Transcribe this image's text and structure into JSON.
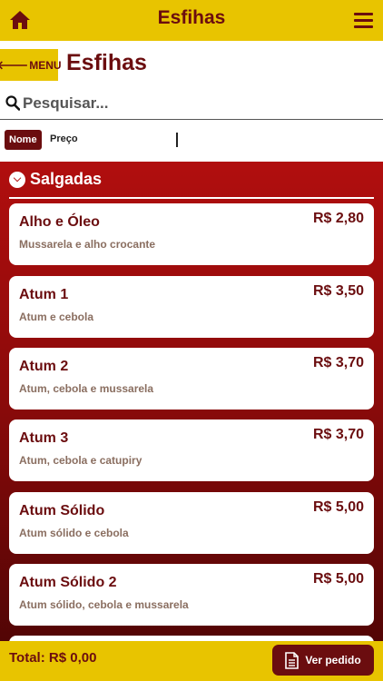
{
  "topbar": {
    "title": "Esfihas",
    "home_icon": "home-icon",
    "menu_icon": "hamburger-menu-icon"
  },
  "header": {
    "back_label": "MENU",
    "back_icon": "arrow-left-icon",
    "title": "Esfihas"
  },
  "search": {
    "placeholder": "Pesquisar...",
    "value": ""
  },
  "sort": {
    "nome": "Nome",
    "preco": "Preço"
  },
  "section": {
    "label": "Salgadas",
    "icon": "chevron-down-circle-icon"
  },
  "items": [
    {
      "name": "Alho e Óleo",
      "desc": "Mussarela e alho crocante",
      "price": "R$ 2,80"
    },
    {
      "name": "Atum 1",
      "desc": "Atum e cebola",
      "price": "R$ 3,50"
    },
    {
      "name": "Atum 2",
      "desc": "Atum, cebola e mussarela",
      "price": "R$ 3,70"
    },
    {
      "name": "Atum 3",
      "desc": "Atum, cebola e catupiry",
      "price": "R$ 3,70"
    },
    {
      "name": "Atum Sólido",
      "desc": "Atum sólido e cebola",
      "price": "R$ 5,00"
    },
    {
      "name": "Atum Sólido 2",
      "desc": "Atum sólido, cebola e mussarela",
      "price": "R$ 5,00"
    }
  ],
  "footer": {
    "total": "Total: R$ 0,00",
    "ver_pedido": "Ver pedido",
    "ver_icon": "document-icon"
  },
  "colors": {
    "yellow": "#e8c400",
    "maroon": "#6b0d0f",
    "red": "#b10e0e"
  }
}
